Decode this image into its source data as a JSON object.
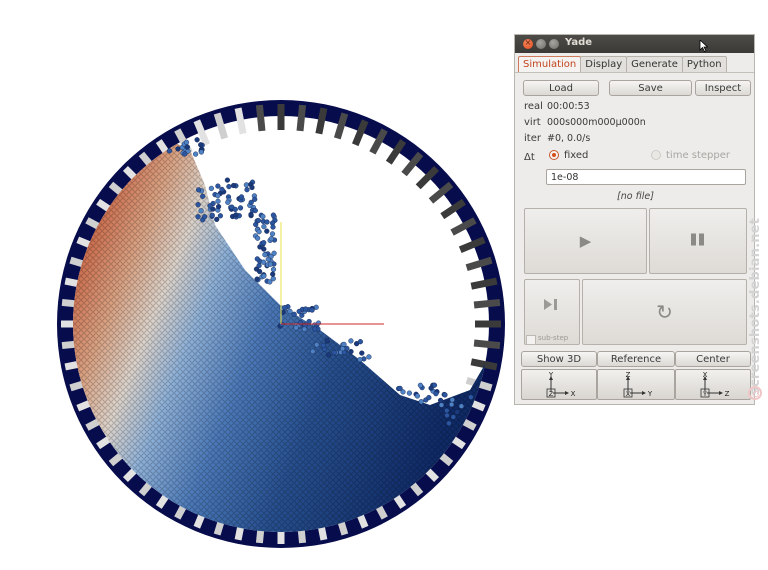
{
  "window": {
    "title": "Yade"
  },
  "tabs": [
    {
      "label": "Simulation",
      "active": true
    },
    {
      "label": "Display",
      "active": false
    },
    {
      "label": "Generate",
      "active": false
    },
    {
      "label": "Python",
      "active": false
    }
  ],
  "simulation": {
    "load_label": "Load",
    "save_label": "Save",
    "inspect_label": "Inspect",
    "real_label": "real",
    "real_value": "00:00:53",
    "virt_label": "virt",
    "virt_value": "000s000m000μ000n",
    "iter_label": "iter",
    "iter_value": "#0, 0.0/s",
    "dt_label": "Δt",
    "fixed_label": "fixed",
    "time_stepper_label": "time stepper",
    "dt_mode": "fixed",
    "dt_value": "1e-08",
    "file_label": "[no file]",
    "substep_label": "sub-step"
  },
  "view_buttons": {
    "show3d_label": "Show 3D",
    "reference_label": "Reference",
    "center_label": "Center"
  },
  "axis_buttons": [
    {
      "up": "Y",
      "box": "Z",
      "right": "X"
    },
    {
      "up": "Z",
      "box": "X",
      "right": "Y"
    },
    {
      "up": "X",
      "box": "Y",
      "right": "Z"
    }
  ],
  "watermark": "screenshots.debian.net",
  "icons": {
    "play": "play-icon",
    "pause": "pause-icon",
    "step": "step-icon",
    "reload": "reload-icon"
  },
  "colors": {
    "accent": "#d94f1b",
    "drum_dark": "#060b4b",
    "particle_red": "#b8402a",
    "particle_blue": "#1e3f86"
  }
}
